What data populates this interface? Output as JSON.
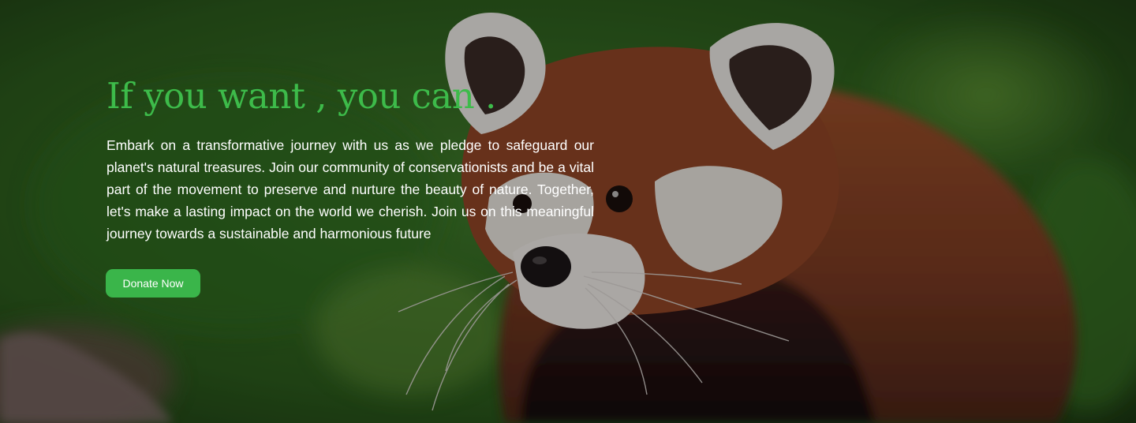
{
  "hero": {
    "title": "If you want , you can .",
    "description": "Embark on a transformative journey with us as we pledge to safeguard our planet's natural treasures. Join our community of conservationists and be a vital part of the movement to preserve and nurture the beauty of nature. Together, let's make a lasting impact on the world we cherish. Join us on this meaningful journey towards a sustainable and harmonious future",
    "donate_label": "Donate Now",
    "background_image": "red-panda-photo"
  },
  "colors": {
    "accent_green": "#3dbb4a",
    "button_green": "#3ab54a",
    "text_white": "#ffffff"
  }
}
